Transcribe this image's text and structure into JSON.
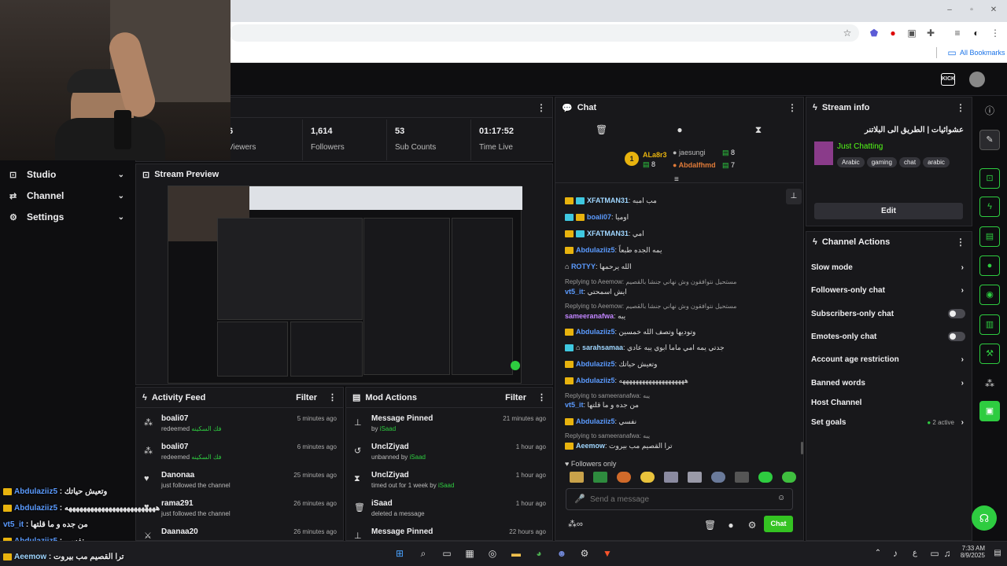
{
  "browser": {
    "bookmarks_label": "All Bookmarks",
    "colors": {
      "accent": "#1a73e8"
    }
  },
  "nav": {
    "items": [
      {
        "label": "Studio",
        "icon": "studio-icon"
      },
      {
        "label": "Channel",
        "icon": "channel-icon"
      },
      {
        "label": "Settings",
        "icon": "gear-icon"
      }
    ]
  },
  "stats": {
    "items": [
      {
        "value": "6",
        "label": "Viewers"
      },
      {
        "value": "1,614",
        "label": "Followers"
      },
      {
        "value": "53",
        "label": "Sub Counts"
      },
      {
        "value": "01:17:52",
        "label": "Time Live"
      }
    ]
  },
  "preview": {
    "title": "Stream Preview"
  },
  "activity": {
    "title": "Activity Feed",
    "filter": "Filter",
    "rows": [
      {
        "who": "boali07",
        "what": "redeemed",
        "reward": "فك السكينه",
        "when": "5 minutes ago",
        "icon": "points-icon"
      },
      {
        "who": "boali07",
        "what": "redeemed",
        "reward": "فك السكينه",
        "when": "6 minutes ago",
        "icon": "points-icon"
      },
      {
        "who": "Danonaa",
        "what": "just followed the channel",
        "reward": "",
        "when": "25 minutes ago",
        "icon": "heart-icon"
      },
      {
        "who": "rama291",
        "what": "just followed the channel",
        "reward": "",
        "when": "26 minutes ago",
        "icon": "heart-icon"
      },
      {
        "who": "Daanaa20",
        "what": "",
        "reward": "",
        "when": "26 minutes ago",
        "icon": "sword-icon"
      }
    ]
  },
  "mod": {
    "title": "Mod Actions",
    "filter": "Filter",
    "rows": [
      {
        "who": "Message Pinned",
        "what": "by",
        "by": "iSaad",
        "when": "21 minutes ago",
        "icon": "pin-icon"
      },
      {
        "who": "UnclZiyad",
        "what": "unbanned by",
        "by": "iSaad",
        "when": "1 hour ago",
        "icon": "undo-icon"
      },
      {
        "who": "UnclZiyad",
        "what": "timed out for 1 week by",
        "by": "iSaad",
        "when": "1 hour ago",
        "icon": "hourglass-icon"
      },
      {
        "who": "iSaad",
        "what": "deleted a message",
        "by": "",
        "when": "1 hour ago",
        "icon": "trash-icon"
      },
      {
        "who": "Message Pinned",
        "what": "",
        "by": "",
        "when": "22 hours ago",
        "icon": "pin-icon"
      }
    ]
  },
  "chat": {
    "title": "Chat",
    "leaderboard": {
      "first": {
        "name": "ALa8r3",
        "points": "8"
      },
      "second": {
        "name": "jaesungi",
        "points": "8"
      },
      "third": {
        "name": "Abdalfhmd",
        "points": "7"
      }
    },
    "messages": [
      {
        "user": "XFATMAN31",
        "text": "مب امبه",
        "style": "u-teal"
      },
      {
        "user": "boali07",
        "text": "اوميا",
        "style": "u-blue"
      },
      {
        "user": "XFATMAN31",
        "text": "امي",
        "style": "u-teal"
      },
      {
        "user": "Abdulaziiz5",
        "text": "يمه الجده طبعاً",
        "style": "u-blue"
      },
      {
        "user": "ROTYY",
        "text": "الله يرحمها",
        "style": "u-blue"
      },
      {
        "reply": "Replying to Aeemow: مستحيل نتوافقون وش نهاني جنشا بالقصيم",
        "user": "vt5_it",
        "text": "ايش اسمحتي",
        "style": "u-blue"
      },
      {
        "reply": "Replying to Aeemow: مستحيل نتوافقون وش نهاني جنشا بالقصيم",
        "user": "sameeranafwa",
        "text": "يبه",
        "style": "u-purple"
      },
      {
        "user": "Abdulaziiz5",
        "text": "وتوديها وتصف الله خمسين",
        "style": "u-blue"
      },
      {
        "user": "sarahsamaa",
        "text": "جدتي يمه امي ماما ابوي يبه عادي",
        "style": "u-teal"
      },
      {
        "user": "Abdulaziiz5",
        "text": "وتعيش حياتك",
        "style": "u-blue"
      },
      {
        "user": "Abdulaziiz5",
        "text": "ههههههههههههههههههههه",
        "style": "u-blue"
      },
      {
        "reply": "Replying to sameeranafwa: يبه",
        "user": "vt5_it",
        "text": "من جده و ما قلتها",
        "style": "u-blue"
      },
      {
        "user": "Abdulaziiz5",
        "text": "نفسي",
        "style": "u-blue"
      },
      {
        "reply": "Replying to sameeranafwa: يبه",
        "user": "Aeemow",
        "text": "ترا القصيم مب بيروت",
        "style": "u-teal"
      }
    ],
    "followers_only": "Followers only",
    "placeholder": "Send a message",
    "send": "Chat"
  },
  "stream_info": {
    "title": "Stream info",
    "stream_title": "عشوائيات | الطريق الى البلاتنر",
    "category": "Just Chatting",
    "tags": [
      "Arabic",
      "gaming",
      "chat",
      "arabic"
    ],
    "edit": "Edit"
  },
  "channel_actions": {
    "title": "Channel Actions",
    "slow_mode": "Slow mode",
    "followers_only": "Followers-only chat",
    "subscribers_only": "Subscribers-only chat",
    "emotes_only": "Emotes-only chat",
    "account_age": "Account age restriction",
    "banned_words": "Banned words",
    "host": "Host Channel",
    "goals": "Set goals",
    "goals_status": "2 active"
  },
  "overlay": [
    {
      "user": "Abdulaziiz5",
      "text": "وتعيش حياتك"
    },
    {
      "user": "Abdulaziiz5",
      "text": "هههههههههههههههههههههههههه"
    },
    {
      "user": "vt5_it",
      "text": "من جده و ما قلتها"
    },
    {
      "user": "Abdulaziiz5",
      "text": "نفسي"
    },
    {
      "user": "Aeemow",
      "text": "ترا القصيم مب بيروت"
    }
  ],
  "taskbar": {
    "time": "7:33 AM",
    "date": "8/9/2025",
    "lang": "ع"
  }
}
